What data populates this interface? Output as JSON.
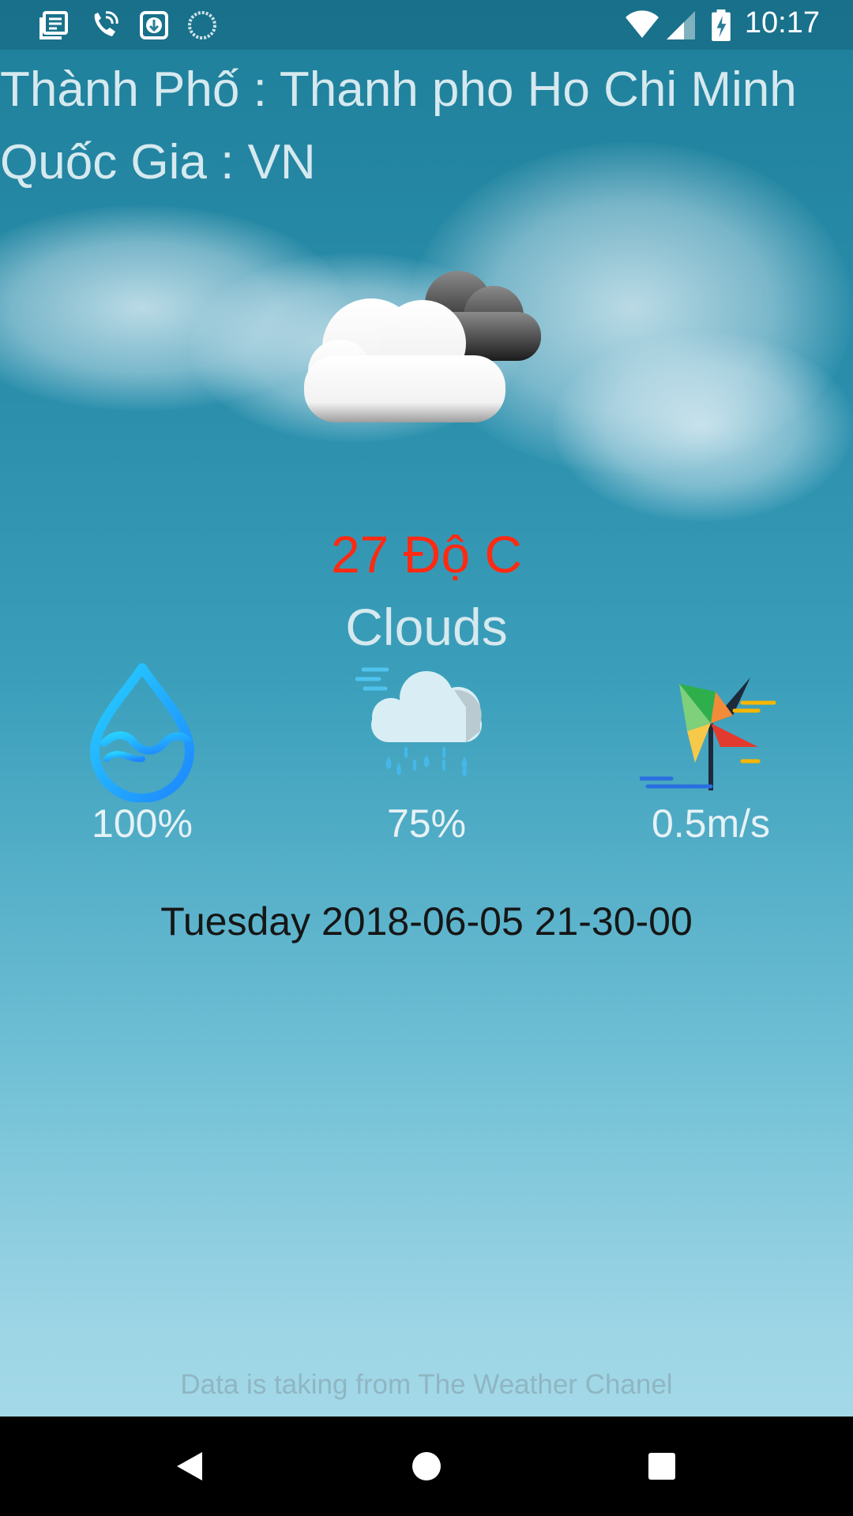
{
  "status_bar": {
    "time": "10:17",
    "left_icons": [
      "news-icon",
      "phone-wifi-call-icon",
      "download-icon",
      "sync-spinner-icon"
    ],
    "right_icons": [
      "wifi-icon",
      "cell-signal-icon",
      "battery-charging-icon"
    ]
  },
  "location": {
    "city_line": "Thành Phố : Thanh pho Ho Chi Minh",
    "country_line": "Quốc Gia : VN"
  },
  "weather": {
    "main_icon": "cloudy-icon",
    "temperature": "27 Độ C",
    "description": "Clouds",
    "temperature_color": "#ff2a12"
  },
  "stats": [
    {
      "icon": "humidity-drop-icon",
      "value": "100%"
    },
    {
      "icon": "rain-cloud-icon",
      "value": "75%"
    },
    {
      "icon": "pinwheel-wind-icon",
      "value": "0.5m/s"
    }
  ],
  "datetime": "Tuesday 2018-06-05 21-30-00",
  "source_note": "Data is taking from The Weather Chanel",
  "nav_bar": {
    "buttons": [
      "back-icon",
      "home-icon",
      "recents-icon"
    ]
  }
}
